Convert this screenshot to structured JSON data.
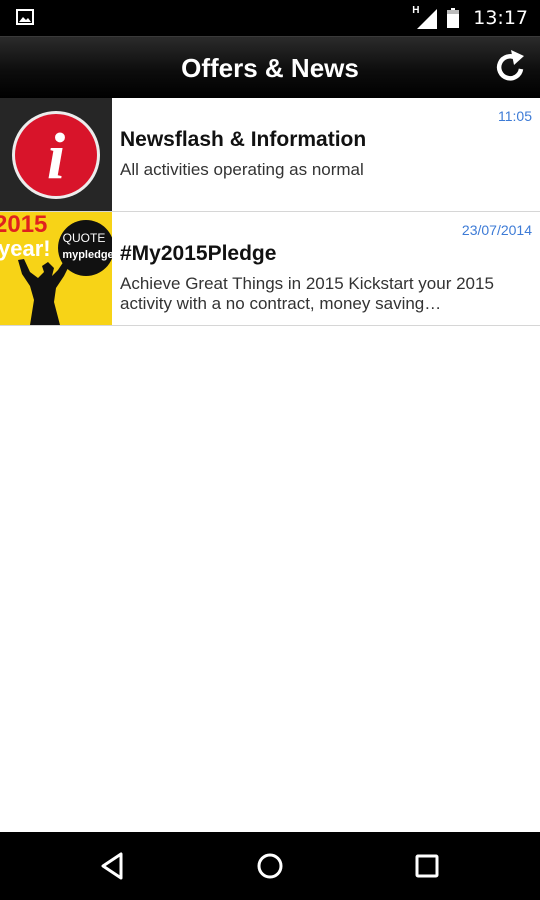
{
  "status_bar": {
    "time": "13:17",
    "network_label": "H",
    "icons": [
      "image-notification-icon",
      "signal-icon",
      "battery-icon"
    ]
  },
  "header": {
    "title": "Offers & News",
    "refresh_icon": "refresh-icon"
  },
  "items": [
    {
      "time": "11:05",
      "title": "Newsflash & Information",
      "description": "All activities operating as normal",
      "thumb_icon": "info-icon"
    },
    {
      "time": "23/07/2014",
      "title": "#My2015Pledge",
      "description": "Achieve Great Things in 2015 Kickstart your 2015 activity with a no contract, money saving…",
      "thumb_text_year": "2015",
      "thumb_text_year_line": "year!",
      "thumb_text_quote": "QUOTE",
      "thumb_text_code": "mypledge"
    }
  ],
  "nav": {
    "back_icon": "back-icon",
    "home_icon": "home-icon",
    "recents_icon": "recents-icon"
  },
  "colors": {
    "accent_time": "#3d7bd6",
    "info_red": "#d8142a",
    "pledge_yellow": "#f7d317"
  }
}
